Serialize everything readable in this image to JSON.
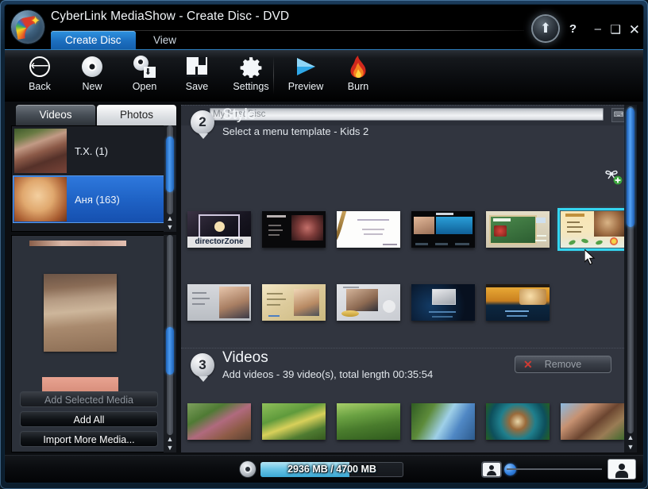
{
  "window": {
    "title": "CyberLink MediaShow - Create Disc - DVD",
    "logo_icon": "app-logo-rainbow-star",
    "controls": {
      "up_icon": "arrow-up-icon",
      "help": "?",
      "minimize": "–",
      "maximize": "❑",
      "close": "✕"
    }
  },
  "tabs": [
    {
      "label": "Create Disc",
      "active": true
    },
    {
      "label": "View",
      "active": false
    }
  ],
  "toolbar": [
    {
      "label": "Back",
      "icon": "back-arrow-icon"
    },
    {
      "label": "New",
      "icon": "disc-icon"
    },
    {
      "label": "Open",
      "icon": "open-folder-disc-icon"
    },
    {
      "label": "Save",
      "icon": "floppy-disk-icon"
    },
    {
      "label": "Settings",
      "icon": "gear-icon"
    },
    {
      "label": "Preview",
      "icon": "play-triangle-icon"
    },
    {
      "label": "Burn",
      "icon": "flame-icon"
    }
  ],
  "library": {
    "tabs": [
      {
        "label": "Videos",
        "active": true
      },
      {
        "label": "Photos",
        "active": false
      }
    ],
    "folders": [
      {
        "name": "Т.Х. (1)",
        "selected": false
      },
      {
        "name": "Аня (163)",
        "selected": true
      }
    ],
    "buttons": [
      {
        "label": "Add Selected Media",
        "enabled": false
      },
      {
        "label": "Add All",
        "enabled": true
      },
      {
        "label": "Import More Media...",
        "enabled": true
      }
    ]
  },
  "disc": {
    "title_value": "My First Disc",
    "title_placeholder": "My First Disc",
    "edit_icon": "keyboard-icon"
  },
  "style_section": {
    "step": "2",
    "title": "Style",
    "subtitle": "Select a menu template - Kids 2",
    "add_icon": "add-ribbon-icon",
    "templates": [
      {
        "name": "directorZone",
        "caption": "directorZone",
        "selected": false
      },
      {
        "name": "dark-cinema",
        "caption": "",
        "selected": false
      },
      {
        "name": "white-brush",
        "caption": "",
        "selected": false
      },
      {
        "name": "blue-bars",
        "caption": "",
        "selected": false
      },
      {
        "name": "green-board",
        "caption": "",
        "selected": false
      },
      {
        "name": "kids-2",
        "caption": "",
        "selected": true
      },
      {
        "name": "wedding-grey",
        "caption": "",
        "selected": false
      },
      {
        "name": "wedding-gold",
        "caption": "",
        "selected": false
      },
      {
        "name": "wedding-kiss",
        "caption": "",
        "selected": false
      },
      {
        "name": "night-blue",
        "caption": "",
        "selected": false
      },
      {
        "name": "sunset-gold",
        "caption": "",
        "selected": false
      }
    ]
  },
  "videos_section": {
    "step": "3",
    "title": "Videos",
    "subtitle": "Add videos - 39 video(s), total length 00:35:54",
    "remove_label": "Remove",
    "remove_icon": "red-x-icon",
    "thumbnails": [
      {
        "name": "video-thumb-1"
      },
      {
        "name": "video-thumb-2"
      },
      {
        "name": "video-thumb-3"
      },
      {
        "name": "video-thumb-4"
      },
      {
        "name": "video-thumb-5"
      },
      {
        "name": "video-thumb-6"
      }
    ]
  },
  "status": {
    "disc_icon": "disc-icon",
    "capacity_text": "2936 MB / 4700 MB",
    "capacity_percent": 62,
    "small_thumb_icon": "small-thumbnail-icon",
    "large_thumb_icon": "large-thumbnail-icon"
  },
  "colors": {
    "accent_blue": "#1f63c6",
    "tab_active": "#1d6fc0",
    "selection_cyan": "#35d5f0",
    "panel_bg": "#31353f",
    "capacity_fill": "#6cc6e6",
    "remove_x_red": "#d03b34"
  }
}
